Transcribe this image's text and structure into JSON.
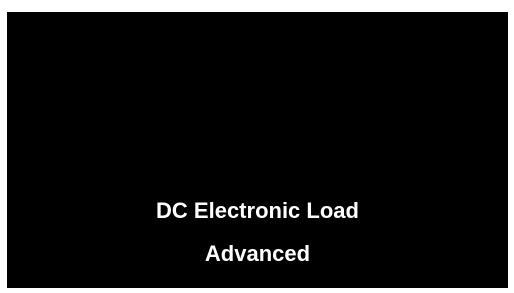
{
  "screen": {
    "background": "#000000",
    "text_color": "#ffffff",
    "lines": [
      "DC Electronic Load",
      "Advanced"
    ]
  }
}
